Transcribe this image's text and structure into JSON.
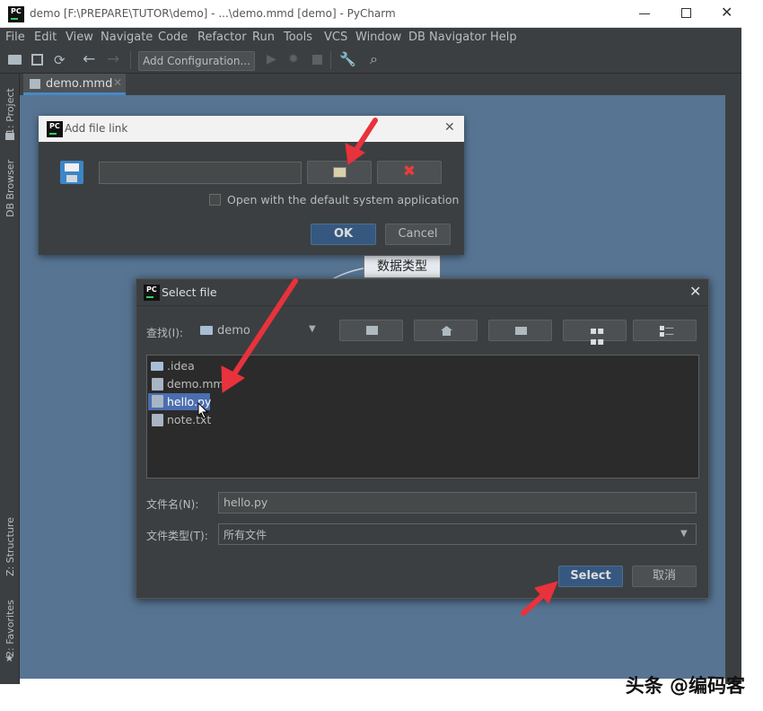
{
  "window": {
    "title": "demo [F:\\PREPARE\\TUTOR\\demo] - ...\\demo.mmd [demo] - PyCharm",
    "logo_text": "PC"
  },
  "menubar": [
    "File",
    "Edit",
    "View",
    "Navigate",
    "Code",
    "Refactor",
    "Run",
    "Tools",
    "VCS",
    "Window",
    "DB Navigator",
    "Help"
  ],
  "toolbar": {
    "run_config_label": "Add Configuration..."
  },
  "editor": {
    "tab_label": "demo.mmd",
    "diagram_node_label": "数据类型"
  },
  "side_panels": {
    "left": [
      "1: Project",
      "DB Browser",
      "Z: Structure",
      "2: Favorites"
    ]
  },
  "add_file_link_dialog": {
    "title": "Add file link",
    "path_value": "",
    "checkbox_label": "Open with the default system application",
    "checkbox_checked": false,
    "ok_label": "OK",
    "cancel_label": "Cancel"
  },
  "select_file_dialog": {
    "title": "Select file",
    "look_in_label": "查找(I):",
    "look_in_value": "demo",
    "files": [
      {
        "name": ".idea",
        "type": "folder",
        "selected": false
      },
      {
        "name": "demo.mmd",
        "type": "file",
        "selected": false
      },
      {
        "name": "hello.py",
        "type": "file",
        "selected": true
      },
      {
        "name": "note.txt",
        "type": "file",
        "selected": false
      }
    ],
    "filename_label": "文件名(N):",
    "filename_value": "hello.py",
    "filetype_label": "文件类型(T):",
    "filetype_value": "所有文件",
    "select_label": "Select",
    "cancel_label": "取消"
  },
  "watermark": "头条 @编码客",
  "colors": {
    "annotation_arrow": "#e8323c",
    "editor_bg": "#577593",
    "ide_chrome": "#3c3f41",
    "selection": "#4b6eaf"
  }
}
